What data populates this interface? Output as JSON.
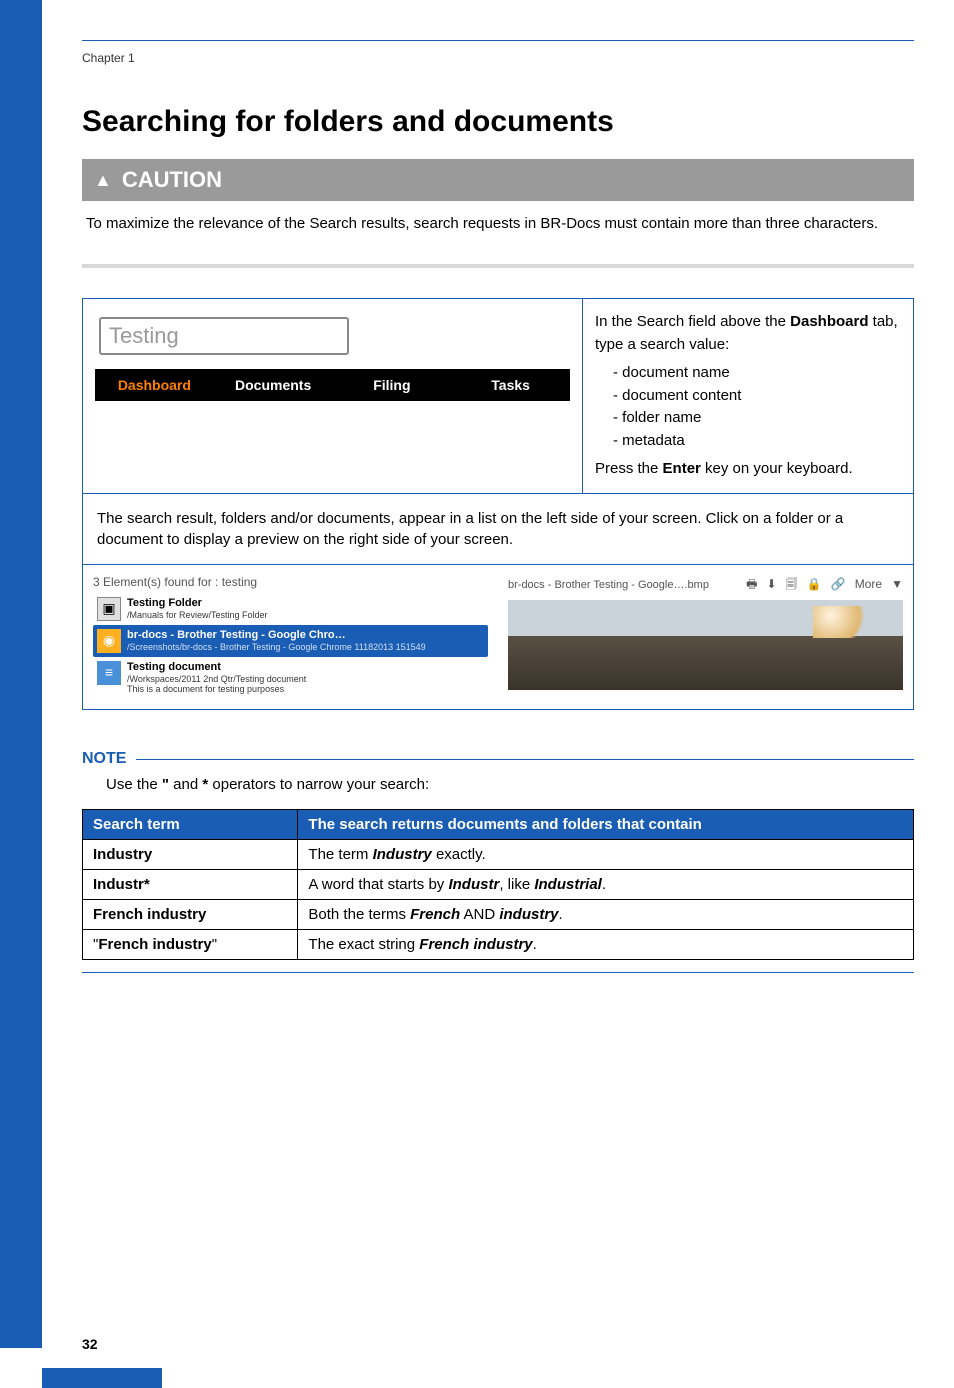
{
  "chapter": "Chapter 1",
  "title": "Searching for folders and documents",
  "caution": {
    "label": "CAUTION",
    "text": "To maximize the relevance of the Search results, search requests in BR-Docs must contain more than three characters."
  },
  "screenshot1": {
    "search_value": "Testing",
    "tabs": [
      "Dashboard",
      "Documents",
      "Filing",
      "Tasks"
    ]
  },
  "instructions": {
    "intro_a": "In the Search field above the ",
    "intro_bold": "Dashboard",
    "intro_b": " tab, type a search value:",
    "bullets": [
      "document name",
      "document content",
      "folder name",
      "metadata"
    ],
    "press_a": "Press the ",
    "press_bold": "Enter",
    "press_b": " key on your keyboard."
  },
  "middle_text": "The search result, folders and/or documents, appear in a list on the left side of your screen. Click on a folder or a document to display a preview on the right side of your screen.",
  "screenshot2": {
    "count": "3 Element(s) found for : testing",
    "results": [
      {
        "title": "Testing Folder",
        "sub": "/Manuals for Review/Testing Folder"
      },
      {
        "title": "br-docs - Brother Testing - Google Chro…",
        "sub": "/Screenshots/br-docs - Brother Testing - Google Chrome 11182013 151549"
      },
      {
        "title": "Testing document",
        "sub": "/Workspaces/2011 2nd Qtr/Testing document\nThis is a document for testing purposes"
      }
    ],
    "preview_title": "br-docs - Brother Testing - Google….bmp",
    "more": "More"
  },
  "note": {
    "label": "NOTE",
    "text_a": "Use the ",
    "op1": "\"",
    "text_b": " and ",
    "op2": "*",
    "text_c": " operators to narrow your search:"
  },
  "table": {
    "headers": [
      "Search term",
      "The search returns documents and folders that contain"
    ],
    "rows": [
      {
        "term": "Industry",
        "desc_pre": "The term ",
        "desc_em": "Industry",
        "desc_post": " exactly."
      },
      {
        "term": "Industr*",
        "desc_pre": "A word that starts by ",
        "desc_em": "Industr",
        "desc_mid": ", like ",
        "desc_em2": "Industrial",
        "desc_post": "."
      },
      {
        "term": "French industry",
        "desc_pre": "Both the terms ",
        "desc_em": "French",
        "desc_mid": " AND ",
        "desc_em2": "industry",
        "desc_post": "."
      },
      {
        "term": "\"French industry\"",
        "term_inner": "French industry",
        "desc_pre": "The exact string ",
        "desc_em": "French industry",
        "desc_post": "."
      }
    ]
  },
  "page_number": "32"
}
